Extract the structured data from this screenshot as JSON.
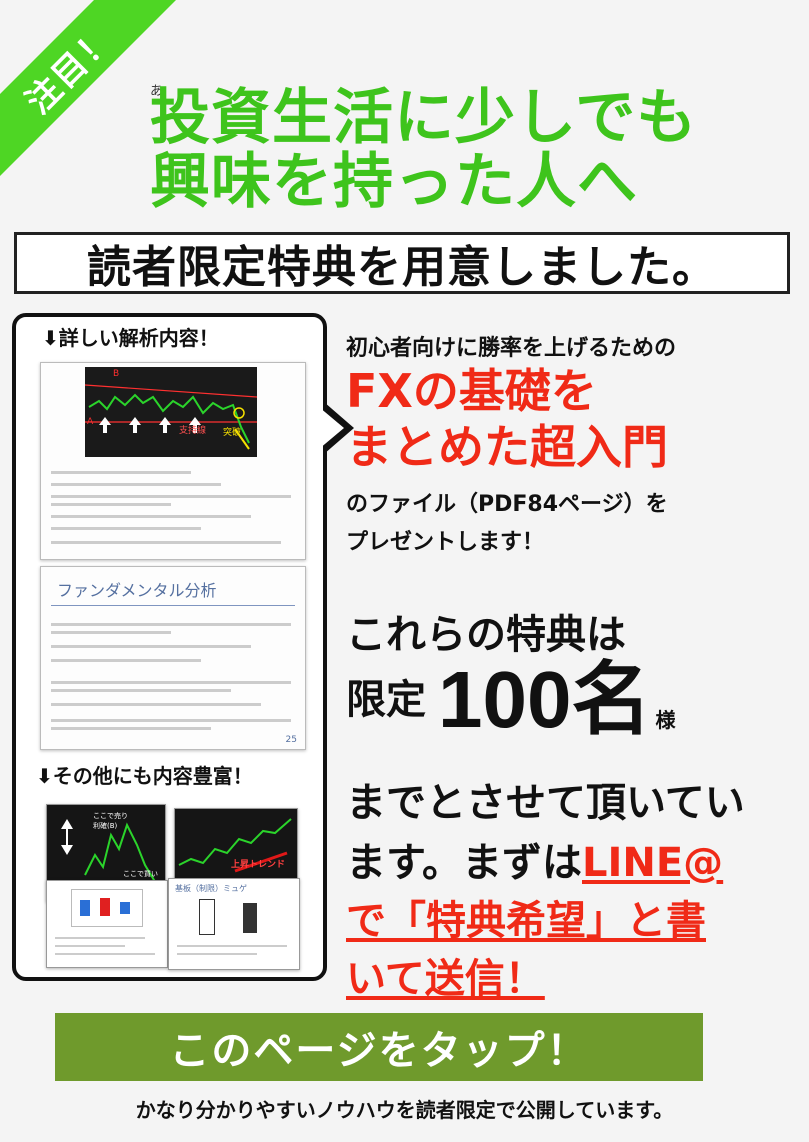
{
  "ribbon": {
    "label": "注目！"
  },
  "small_mark": "あ",
  "headline": {
    "line1": "投資生活に少しでも",
    "line2": "興味を持った人へ"
  },
  "subtitle": "読者限定特典を用意しました。",
  "bubble": {
    "heading1": "⬇詳しい解析内容！",
    "heading2": "⬇その他にも内容豊富！",
    "slide1": {
      "label_b": "B",
      "label_a": "A",
      "support_label": "支持線",
      "breakout_label": "突破"
    },
    "slide2": {
      "title": "ファンダメンタル分析",
      "page_no": "25"
    },
    "thumb1": {
      "label": "ここで売り\n利確(B)",
      "label2": "ここで買い"
    },
    "thumb2": {
      "label": "上昇トレンド"
    },
    "thumb4": {
      "title": "基板（制限）ミュゲ"
    }
  },
  "offer": {
    "line1": "初心者向けに勝率を上げるための",
    "big1": "FXの基礎を",
    "big2": "まとめた超入門",
    "line2": "のファイル（PDF84ページ）を",
    "line3": "プレゼントします！"
  },
  "limit": {
    "line1": "これらの特典は",
    "prefix": "限定",
    "number": "100名",
    "suffix": "様",
    "line2": "までとさせて頂いてい",
    "line3a": "ます。まずは",
    "line3b": "LINE@",
    "line4": "で「特典希望」と書",
    "line5": "いて送信！"
  },
  "cta": {
    "label": "このページをタップ！"
  },
  "footer": "かなり分かりやすいノウハウを読者限定で公開しています。",
  "colors": {
    "green": "#3ec41c",
    "ribbon": "#4ed624",
    "red": "#f02a17",
    "cta": "#6f9a2c"
  }
}
